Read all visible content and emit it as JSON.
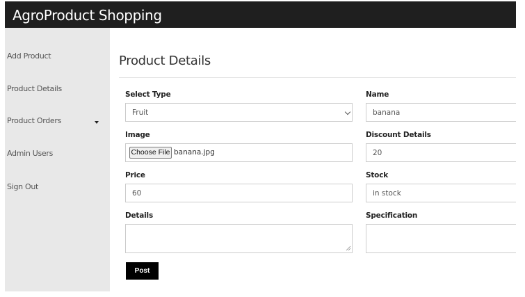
{
  "header": {
    "brand": "AgroProduct Shopping"
  },
  "sidebar": {
    "items": [
      {
        "label": "Add Product"
      },
      {
        "label": "Product Details"
      },
      {
        "label": "Product Orders"
      },
      {
        "label": "Admin Users"
      },
      {
        "label": "Sign Out"
      }
    ]
  },
  "main": {
    "title": "Product Details",
    "form": {
      "select_type": {
        "label": "Select Type",
        "value": "Fruit"
      },
      "name": {
        "label": "Name",
        "value": "banana"
      },
      "image": {
        "label": "Image",
        "button": "Choose File",
        "file": "banana.jpg"
      },
      "discount": {
        "label": "Discount Details",
        "value": "20"
      },
      "price": {
        "label": "Price",
        "value": "60"
      },
      "stock": {
        "label": "Stock",
        "value": "in stock"
      },
      "details": {
        "label": "Details",
        "value": ""
      },
      "specification": {
        "label": "Specification",
        "value": ""
      },
      "submit": "Post"
    }
  }
}
